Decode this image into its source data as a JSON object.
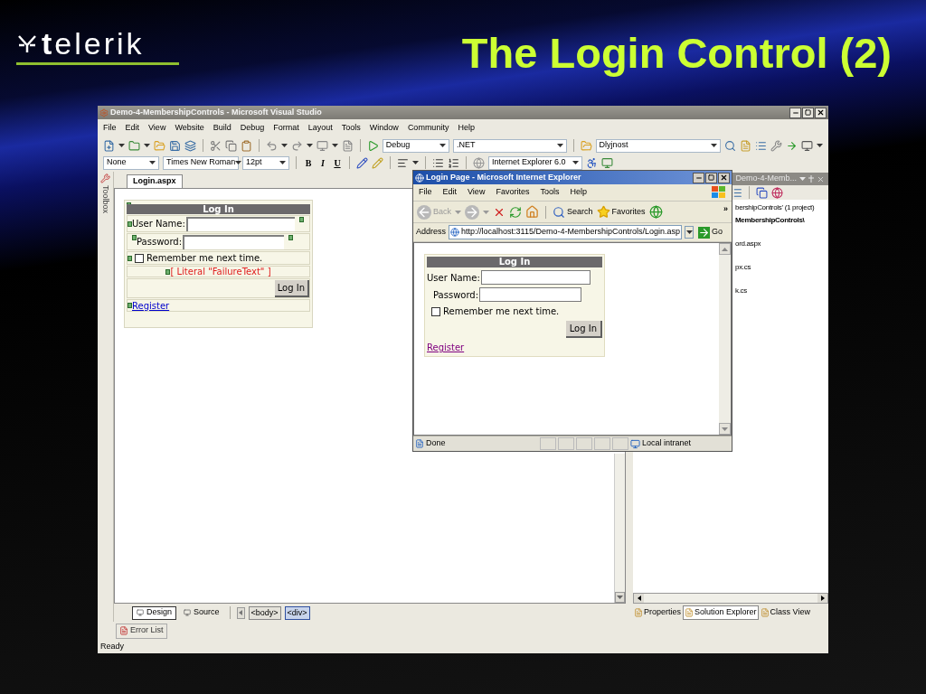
{
  "slide": {
    "logo": "**t**elerik",
    "title": "The Login Control (2)"
  },
  "vs": {
    "title": "Demo-4-MembershipControls - Microsoft Visual Studio",
    "menu": [
      "File",
      "Edit",
      "View",
      "Website",
      "Build",
      "Debug",
      "Format",
      "Layout",
      "Tools",
      "Window",
      "Community",
      "Help"
    ],
    "config_combo": "Debug",
    "platform_combo": ".NET",
    "find_combo": "Dlyjnost",
    "style_combo": "None",
    "font_combo": "Times New Roman",
    "size_combo": "12pt",
    "format_buttons": [
      "B",
      "I",
      "U"
    ],
    "target_combo": "Internet Explorer 6.0",
    "toolbox_label": "Toolbox",
    "doc_tabs": [
      {
        "label": "Login.aspx",
        "selected": true
      }
    ],
    "login": {
      "title": "Log In",
      "user_label": "User Name:",
      "password_label": "Password:",
      "remember": "Remember me next time.",
      "checked": false,
      "failure": "[ Literal \"FailureText\" ]",
      "button": "Log In",
      "link": "Register"
    },
    "view_tabs": [
      {
        "label": "Design",
        "selected": true
      },
      {
        "label": "Source",
        "selected": false
      }
    ],
    "tag_path": [
      {
        "label": "<body>",
        "selected": false
      },
      {
        "label": "<div>",
        "selected": true
      }
    ],
    "panel": {
      "title": "Demo-4-Memb...",
      "lines": [
        {
          "text": "bershipControls' (1 project)",
          "bold": false
        },
        {
          "text": "MembershipControls\\",
          "bold": true
        },
        {
          "text": "ord.aspx",
          "bold": false
        },
        {
          "text": "px.cs",
          "bold": false
        },
        {
          "text": "k.cs",
          "bold": false
        }
      ],
      "tabs": [
        {
          "label": "Properties",
          "selected": false
        },
        {
          "label": "Solution Explorer",
          "selected": true
        },
        {
          "label": "Class View",
          "selected": false
        }
      ]
    },
    "error_list": "Error List",
    "status": "Ready"
  },
  "ie": {
    "title": "Login Page - Microsoft Internet Explorer",
    "menu": [
      "File",
      "Edit",
      "View",
      "Favorites",
      "Tools",
      "Help"
    ],
    "back": {
      "label": "Back",
      "disabled": true
    },
    "search": "Search",
    "favorites": "Favorites",
    "chevron": "»",
    "address_label": "Address",
    "url": "http://localhost:3115/Demo-4-MembershipControls/Login.asp",
    "go": "Go",
    "login": {
      "title": "Log In",
      "user_label": "User Name:",
      "password_label": "Password:",
      "remember": "Remember me next time.",
      "checked": false,
      "button": "Log In",
      "link": "Register"
    },
    "status": "Done",
    "zone": "Local intranet"
  }
}
